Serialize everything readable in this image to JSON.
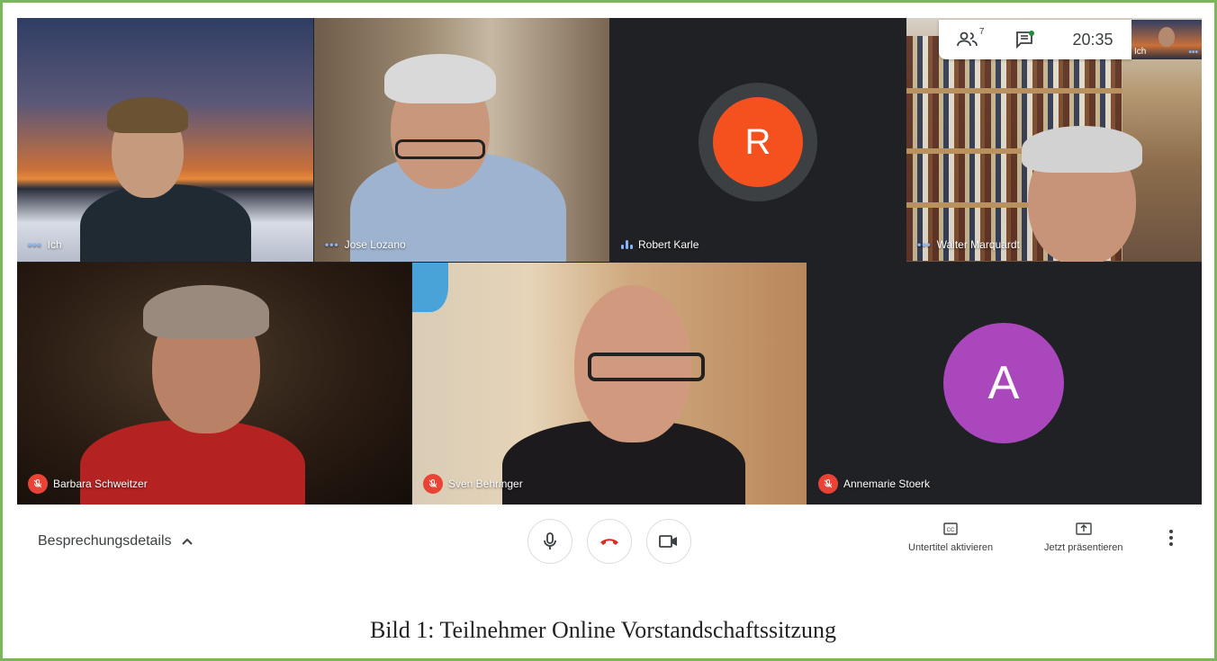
{
  "participants": [
    {
      "name": "Ich",
      "status": "dots"
    },
    {
      "name": "Jose Lozano",
      "status": "dots"
    },
    {
      "name": "Robert Karle",
      "status": "speaking",
      "avatar_letter": "R",
      "avatar_color": "#f4511e"
    },
    {
      "name": "Walter Marquardt",
      "status": "dots"
    },
    {
      "name": "Barbara Schweitzer",
      "status": "muted"
    },
    {
      "name": "Sven Behringer",
      "status": "muted"
    },
    {
      "name": "Annemarie Stoerk",
      "status": "muted",
      "avatar_letter": "A",
      "avatar_color": "#ab47bc"
    }
  ],
  "topbar": {
    "people_count": "7",
    "time": "20:35",
    "self_label": "Ich"
  },
  "toolbar": {
    "details_label": "Besprechungsdetails",
    "captions_label": "Untertitel aktivieren",
    "present_label": "Jetzt präsentieren"
  },
  "caption": "Bild 1: Teilnehmer Online Vorstandschaftssitzung",
  "colors": {
    "accent_blue": "#8ab4f8",
    "mute_red": "#ea4335",
    "stage_bg": "#202124",
    "frame_green": "#7bb65a"
  }
}
